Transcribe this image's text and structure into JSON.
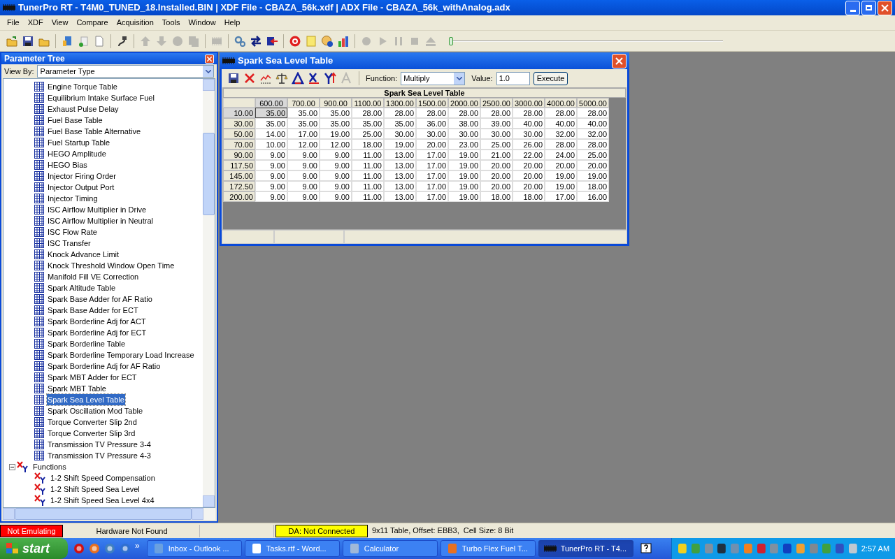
{
  "window": {
    "title": "TunerPro RT - T4M0_TUNED_18.Installed.BIN | XDF File - CBAZA_56k.xdf | ADX File - CBAZA_56k_withAnalog.adx"
  },
  "menu": [
    "File",
    "XDF",
    "View",
    "Compare",
    "Acquisition",
    "Tools",
    "Window",
    "Help"
  ],
  "toolbar": [
    {
      "kind": "open",
      "disabled": false
    },
    {
      "kind": "save",
      "disabled": false
    },
    {
      "kind": "folder",
      "disabled": false
    },
    {
      "kind": "sep"
    },
    {
      "kind": "bluedoc",
      "disabled": false
    },
    {
      "kind": "newdoc",
      "disabled": false
    },
    {
      "kind": "page",
      "disabled": false
    },
    {
      "kind": "sep"
    },
    {
      "kind": "plug",
      "disabled": false
    },
    {
      "kind": "sep"
    },
    {
      "kind": "up",
      "disabled": true
    },
    {
      "kind": "down",
      "disabled": true
    },
    {
      "kind": "circle",
      "disabled": true
    },
    {
      "kind": "pages",
      "disabled": true
    },
    {
      "kind": "sep"
    },
    {
      "kind": "chip",
      "disabled": true
    },
    {
      "kind": "sep"
    },
    {
      "kind": "gears",
      "disabled": false
    },
    {
      "kind": "swap",
      "disabled": false
    },
    {
      "kind": "chiparrow",
      "disabled": false
    },
    {
      "kind": "sep"
    },
    {
      "kind": "target",
      "disabled": false
    },
    {
      "kind": "note",
      "disabled": false
    },
    {
      "kind": "dial",
      "disabled": false
    },
    {
      "kind": "bars",
      "disabled": false
    },
    {
      "kind": "sep"
    },
    {
      "kind": "record",
      "disabled": true
    },
    {
      "kind": "play",
      "disabled": true
    },
    {
      "kind": "pause",
      "disabled": true
    },
    {
      "kind": "stop",
      "disabled": true
    },
    {
      "kind": "eject",
      "disabled": true
    }
  ],
  "playback": {
    "level": 0.0
  },
  "tree_panel": {
    "title": "Parameter Tree",
    "view_by_label": "View By:",
    "view_by_value": "Parameter Type",
    "items": [
      {
        "kind": "table",
        "label": "Engine Torque Table",
        "selected": false
      },
      {
        "kind": "table",
        "label": "Equilibrium Intake Surface Fuel",
        "selected": false
      },
      {
        "kind": "table",
        "label": "Exhaust Pulse Delay",
        "selected": false
      },
      {
        "kind": "table",
        "label": "Fuel Base Table",
        "selected": false
      },
      {
        "kind": "table",
        "label": "Fuel Base Table Alternative",
        "selected": false
      },
      {
        "kind": "table",
        "label": "Fuel Startup Table",
        "selected": false
      },
      {
        "kind": "table",
        "label": "HEGO Amplitude",
        "selected": false
      },
      {
        "kind": "table",
        "label": "HEGO Bias",
        "selected": false
      },
      {
        "kind": "table",
        "label": "Injector Firing Order",
        "selected": false
      },
      {
        "kind": "table",
        "label": "Injector Output Port",
        "selected": false
      },
      {
        "kind": "table",
        "label": "Injector Timing",
        "selected": false
      },
      {
        "kind": "table",
        "label": "ISC Airflow Multiplier in Drive",
        "selected": false
      },
      {
        "kind": "table",
        "label": "ISC Airflow Multiplier in Neutral",
        "selected": false
      },
      {
        "kind": "table",
        "label": "ISC Flow Rate",
        "selected": false
      },
      {
        "kind": "table",
        "label": "ISC Transfer",
        "selected": false
      },
      {
        "kind": "table",
        "label": "Knock Advance Limit",
        "selected": false
      },
      {
        "kind": "table",
        "label": "Knock Threshold Window Open Time",
        "selected": false
      },
      {
        "kind": "table",
        "label": "Manifold Fill VE Correction",
        "selected": false
      },
      {
        "kind": "table",
        "label": "Spark Altitude Table",
        "selected": false
      },
      {
        "kind": "table",
        "label": "Spark Base Adder for AF Ratio",
        "selected": false
      },
      {
        "kind": "table",
        "label": "Spark Base Adder for ECT",
        "selected": false
      },
      {
        "kind": "table",
        "label": "Spark Borderline Adj for ACT",
        "selected": false
      },
      {
        "kind": "table",
        "label": "Spark Borderline Adj for ECT",
        "selected": false
      },
      {
        "kind": "table",
        "label": "Spark Borderline Table",
        "selected": false
      },
      {
        "kind": "table",
        "label": "Spark Borderline Temporary Load Increase",
        "selected": false
      },
      {
        "kind": "table",
        "label": "Spark Borderline Adj for AF Ratio",
        "selected": false
      },
      {
        "kind": "table",
        "label": "Spark MBT Adder for ECT",
        "selected": false
      },
      {
        "kind": "table",
        "label": "Spark MBT Table",
        "selected": false
      },
      {
        "kind": "table",
        "label": "Spark Sea Level Table",
        "selected": true
      },
      {
        "kind": "table",
        "label": "Spark Oscillation Mod Table",
        "selected": false
      },
      {
        "kind": "table",
        "label": "Torque Converter Slip 2nd",
        "selected": false
      },
      {
        "kind": "table",
        "label": "Torque Converter Slip 3rd",
        "selected": false
      },
      {
        "kind": "table",
        "label": "Transmission TV Pressure 3-4",
        "selected": false
      },
      {
        "kind": "table",
        "label": "Transmission TV Pressure 4-3",
        "selected": false
      },
      {
        "kind": "function",
        "label": "Functions",
        "selected": false,
        "expanded": true,
        "children": [
          {
            "kind": "function",
            "label": "1-2 Shift Speed Compensation",
            "selected": false
          },
          {
            "kind": "function",
            "label": "1-2 Shift Speed Sea Level",
            "selected": false
          },
          {
            "kind": "function",
            "label": "1-2 Shift Speed Sea Level 4x4",
            "selected": false
          }
        ]
      }
    ]
  },
  "table_window": {
    "title": "Spark Sea Level Table",
    "tools": [
      {
        "kind": "save",
        "disabled": false
      },
      {
        "kind": "delete",
        "disabled": false
      },
      {
        "kind": "graph",
        "disabled": false
      },
      {
        "kind": "scales",
        "disabled": false
      },
      {
        "kind": "triangle",
        "disabled": false
      },
      {
        "kind": "xaxis",
        "disabled": false
      },
      {
        "kind": "yaxis",
        "disabled": false
      },
      {
        "kind": "letter",
        "disabled": true
      }
    ],
    "function_label": "Function:",
    "function_value": "Multiply",
    "value_label": "Value:",
    "value": "1.0",
    "execute": "Execute",
    "table": {
      "title": "Spark Sea Level Table",
      "columns": [
        "600.00",
        "700.00",
        "900.00",
        "1100.00",
        "1300.00",
        "1500.00",
        "2000.00",
        "2500.00",
        "3000.00",
        "4000.00",
        "5000.00"
      ],
      "rows": [
        {
          "label": "10.00",
          "cells": [
            {
              "v": "35.00",
              "selected": true
            },
            {
              "v": "35.00",
              "selected": false
            },
            {
              "v": "35.00",
              "selected": false
            },
            {
              "v": "28.00",
              "selected": false
            },
            {
              "v": "28.00",
              "selected": false
            },
            {
              "v": "28.00",
              "selected": false
            },
            {
              "v": "28.00",
              "selected": false
            },
            {
              "v": "28.00",
              "selected": false
            },
            {
              "v": "28.00",
              "selected": false
            },
            {
              "v": "28.00",
              "selected": false
            },
            {
              "v": "28.00",
              "selected": false
            }
          ]
        },
        {
          "label": "30.00",
          "cells": [
            {
              "v": "35.00",
              "selected": false
            },
            {
              "v": "35.00",
              "selected": false
            },
            {
              "v": "35.00",
              "selected": false
            },
            {
              "v": "35.00",
              "selected": false
            },
            {
              "v": "35.00",
              "selected": false
            },
            {
              "v": "36.00",
              "selected": false
            },
            {
              "v": "38.00",
              "selected": false
            },
            {
              "v": "39.00",
              "selected": false
            },
            {
              "v": "40.00",
              "selected": false
            },
            {
              "v": "40.00",
              "selected": false
            },
            {
              "v": "40.00",
              "selected": false
            }
          ]
        },
        {
          "label": "50.00",
          "cells": [
            {
              "v": "14.00",
              "selected": false
            },
            {
              "v": "17.00",
              "selected": false
            },
            {
              "v": "19.00",
              "selected": false
            },
            {
              "v": "25.00",
              "selected": false
            },
            {
              "v": "30.00",
              "selected": false
            },
            {
              "v": "30.00",
              "selected": false
            },
            {
              "v": "30.00",
              "selected": false
            },
            {
              "v": "30.00",
              "selected": false
            },
            {
              "v": "30.00",
              "selected": false
            },
            {
              "v": "32.00",
              "selected": false
            },
            {
              "v": "32.00",
              "selected": false
            }
          ]
        },
        {
          "label": "70.00",
          "cells": [
            {
              "v": "10.00",
              "selected": false
            },
            {
              "v": "12.00",
              "selected": false
            },
            {
              "v": "12.00",
              "selected": false
            },
            {
              "v": "18.00",
              "selected": false
            },
            {
              "v": "19.00",
              "selected": false
            },
            {
              "v": "20.00",
              "selected": false
            },
            {
              "v": "23.00",
              "selected": false
            },
            {
              "v": "25.00",
              "selected": false
            },
            {
              "v": "26.00",
              "selected": false
            },
            {
              "v": "28.00",
              "selected": false
            },
            {
              "v": "28.00",
              "selected": false
            }
          ]
        },
        {
          "label": "90.00",
          "cells": [
            {
              "v": "9.00",
              "selected": false
            },
            {
              "v": "9.00",
              "selected": false
            },
            {
              "v": "9.00",
              "selected": false
            },
            {
              "v": "11.00",
              "selected": false
            },
            {
              "v": "13.00",
              "selected": false
            },
            {
              "v": "17.00",
              "selected": false
            },
            {
              "v": "19.00",
              "selected": false
            },
            {
              "v": "21.00",
              "selected": false
            },
            {
              "v": "22.00",
              "selected": false
            },
            {
              "v": "24.00",
              "selected": false
            },
            {
              "v": "25.00",
              "selected": false
            }
          ]
        },
        {
          "label": "117.50",
          "cells": [
            {
              "v": "9.00",
              "selected": false
            },
            {
              "v": "9.00",
              "selected": false
            },
            {
              "v": "9.00",
              "selected": false
            },
            {
              "v": "11.00",
              "selected": false
            },
            {
              "v": "13.00",
              "selected": false
            },
            {
              "v": "17.00",
              "selected": false
            },
            {
              "v": "19.00",
              "selected": false
            },
            {
              "v": "20.00",
              "selected": false
            },
            {
              "v": "20.00",
              "selected": false
            },
            {
              "v": "20.00",
              "selected": false
            },
            {
              "v": "20.00",
              "selected": false
            }
          ]
        },
        {
          "label": "145.00",
          "cells": [
            {
              "v": "9.00",
              "selected": false
            },
            {
              "v": "9.00",
              "selected": false
            },
            {
              "v": "9.00",
              "selected": false
            },
            {
              "v": "11.00",
              "selected": false
            },
            {
              "v": "13.00",
              "selected": false
            },
            {
              "v": "17.00",
              "selected": false
            },
            {
              "v": "19.00",
              "selected": false
            },
            {
              "v": "20.00",
              "selected": false
            },
            {
              "v": "20.00",
              "selected": false
            },
            {
              "v": "19.00",
              "selected": false
            },
            {
              "v": "19.00",
              "selected": false
            }
          ]
        },
        {
          "label": "172.50",
          "cells": [
            {
              "v": "9.00",
              "selected": false
            },
            {
              "v": "9.00",
              "selected": false
            },
            {
              "v": "9.00",
              "selected": false
            },
            {
              "v": "11.00",
              "selected": false
            },
            {
              "v": "13.00",
              "selected": false
            },
            {
              "v": "17.00",
              "selected": false
            },
            {
              "v": "19.00",
              "selected": false
            },
            {
              "v": "20.00",
              "selected": false
            },
            {
              "v": "20.00",
              "selected": false
            },
            {
              "v": "19.00",
              "selected": false
            },
            {
              "v": "18.00",
              "selected": false
            }
          ]
        },
        {
          "label": "200.00",
          "cells": [
            {
              "v": "9.00",
              "selected": false
            },
            {
              "v": "9.00",
              "selected": false
            },
            {
              "v": "9.00",
              "selected": false
            },
            {
              "v": "11.00",
              "selected": false
            },
            {
              "v": "13.00",
              "selected": false
            },
            {
              "v": "17.00",
              "selected": false
            },
            {
              "v": "19.00",
              "selected": false
            },
            {
              "v": "18.00",
              "selected": false
            },
            {
              "v": "18.00",
              "selected": false
            },
            {
              "v": "17.00",
              "selected": false
            },
            {
              "v": "16.00",
              "selected": false
            }
          ]
        }
      ]
    }
  },
  "status_bar": {
    "emulation": "Not Emulating",
    "hardware": "Hardware Not Found",
    "da": "DA: Not Connected",
    "info": "9x11 Table, Offset: EBB3,  Cell Size: 8 Bit"
  },
  "taskbar": {
    "start": "start",
    "more": "»",
    "buttons": [
      {
        "kind": "outlook",
        "label": "Inbox - Outlook ...",
        "selected": false
      },
      {
        "kind": "word",
        "label": "Tasks.rtf - Word...",
        "selected": false
      },
      {
        "kind": "calc",
        "label": "Calculator",
        "selected": false
      },
      {
        "kind": "firefox",
        "label": "Turbo Flex Fuel T...",
        "selected": false
      },
      {
        "kind": "chip",
        "label": "TunerPro RT - T4...",
        "selected": true
      }
    ],
    "clock": "2:57 AM"
  }
}
